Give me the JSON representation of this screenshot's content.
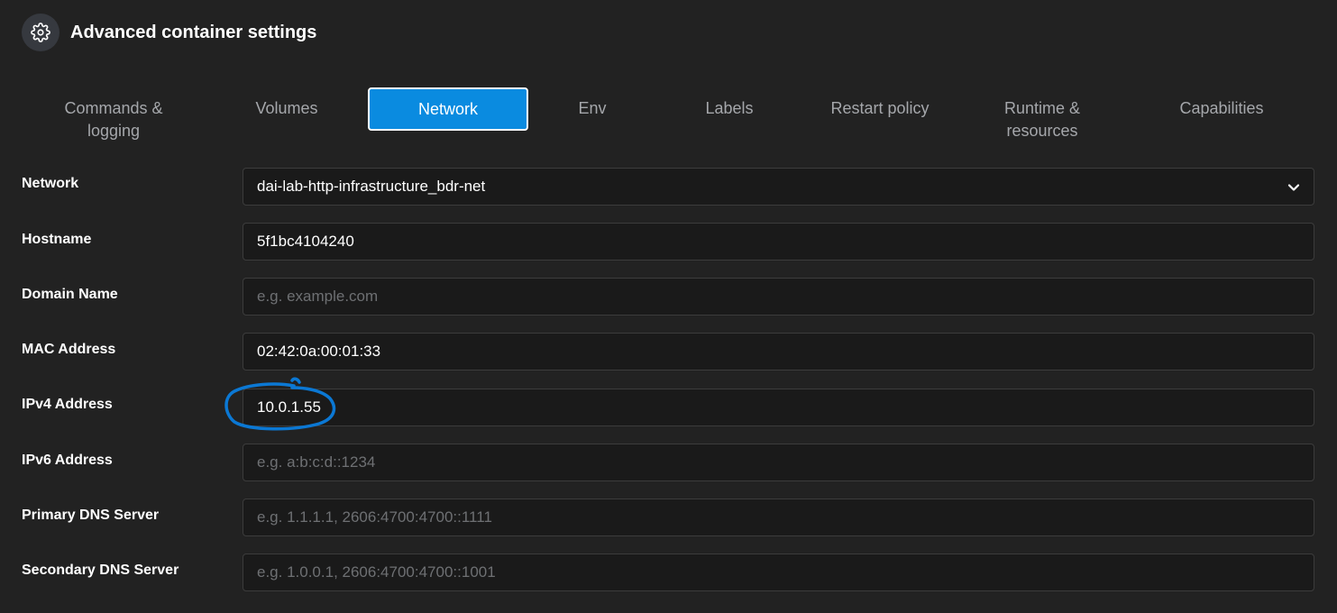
{
  "header": {
    "title": "Advanced container settings",
    "icon": "gear-icon"
  },
  "tabs": [
    {
      "label_lines": [
        "Commands &",
        "logging"
      ],
      "active": false
    },
    {
      "label_lines": [
        "Volumes"
      ],
      "active": false
    },
    {
      "label_lines": [
        "Network"
      ],
      "active": true
    },
    {
      "label_lines": [
        "Env"
      ],
      "active": false
    },
    {
      "label_lines": [
        "Labels"
      ],
      "active": false
    },
    {
      "label_lines": [
        "Restart policy"
      ],
      "active": false
    },
    {
      "label_lines": [
        "Runtime &",
        "resources"
      ],
      "active": false
    },
    {
      "label_lines": [
        "Capabilities"
      ],
      "active": false
    }
  ],
  "form": {
    "network": {
      "label": "Network",
      "value": "dai-lab-http-infrastructure_bdr-net"
    },
    "hostname": {
      "label": "Hostname",
      "value": "5f1bc4104240"
    },
    "domain_name": {
      "label": "Domain Name",
      "value": "",
      "placeholder": "e.g. example.com"
    },
    "mac_address": {
      "label": "MAC Address",
      "value": "02:42:0a:00:01:33"
    },
    "ipv4_address": {
      "label": "IPv4 Address",
      "value": "10.0.1.55"
    },
    "ipv6_address": {
      "label": "IPv6 Address",
      "value": "",
      "placeholder": "e.g. a:b:c:d::1234"
    },
    "primary_dns": {
      "label": "Primary DNS Server",
      "value": "",
      "placeholder": "e.g. 1.1.1.1, 2606:4700:4700::1111"
    },
    "secondary_dns": {
      "label": "Secondary DNS Server",
      "value": "",
      "placeholder": "e.g. 1.0.0.1, 2606:4700:4700::1001"
    }
  },
  "colors": {
    "background": "#222222",
    "active_tab": "#0a8be0",
    "annotation": "#0b78d4"
  }
}
